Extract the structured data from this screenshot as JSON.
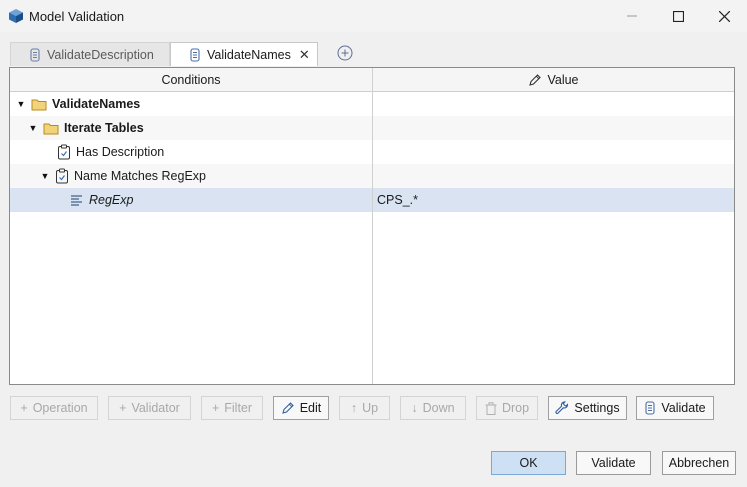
{
  "window": {
    "title": "Model Validation"
  },
  "tabs": [
    {
      "label": "ValidateDescription",
      "active": false
    },
    {
      "label": "ValidateNames",
      "active": true,
      "closable": true
    }
  ],
  "grid": {
    "columns": {
      "conditions": "Conditions",
      "value": "Value"
    },
    "rows": [
      {
        "label": "ValidateNames",
        "value": "",
        "icon": "folder-icon",
        "expanded": true,
        "bold": true
      },
      {
        "label": "Iterate Tables",
        "value": "",
        "icon": "folder-icon",
        "expanded": true,
        "bold": true
      },
      {
        "label": "Has Description",
        "value": "",
        "icon": "clipboard-check-icon"
      },
      {
        "label": "Name Matches RegExp",
        "value": "",
        "icon": "clipboard-check-icon",
        "expanded": true
      },
      {
        "label": "RegExp",
        "value": "CPS_.*",
        "icon": "lines-icon",
        "italic": true,
        "selected": true
      }
    ]
  },
  "toolbar": {
    "operation": "Operation",
    "validator": "Validator",
    "filter": "Filter",
    "edit": "Edit",
    "up": "Up",
    "down": "Down",
    "drop": "Drop",
    "settings": "Settings",
    "validate": "Validate"
  },
  "dialog": {
    "ok": "OK",
    "validate": "Validate",
    "cancel": "Abbrechen"
  },
  "colors": {
    "selection": "#d9e3f2",
    "primary_button": "#cde0f4",
    "folder": "#e8c15a"
  }
}
